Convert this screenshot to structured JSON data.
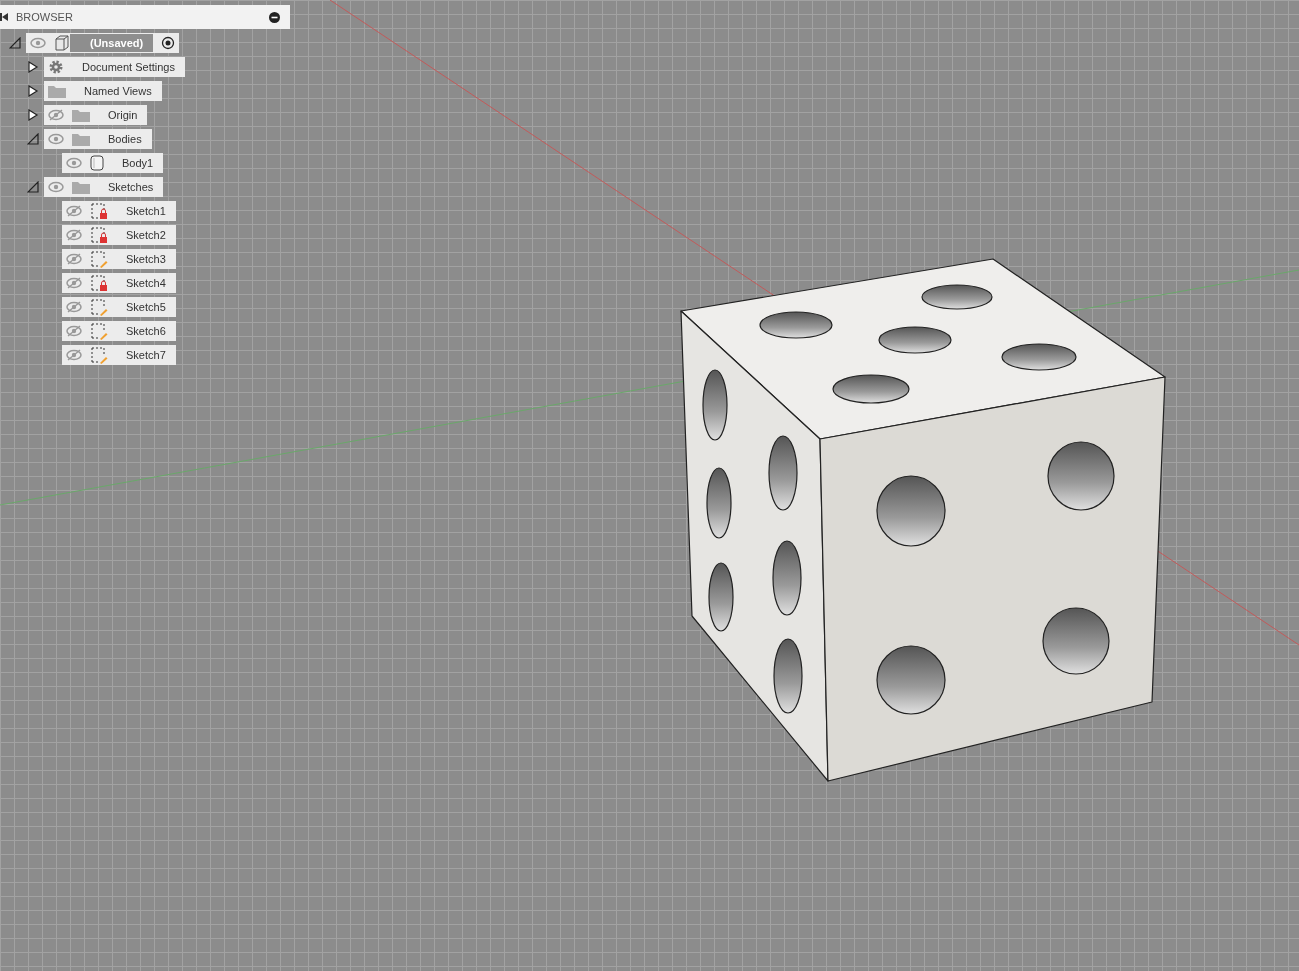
{
  "browser": {
    "title": "BROWSER",
    "tree": [
      {
        "kind": "component",
        "label": "(Unsaved)",
        "expanded": true,
        "visible": true,
        "active": true,
        "children": [
          {
            "kind": "settings",
            "label": "Document Settings",
            "expanded": false
          },
          {
            "kind": "folder",
            "label": "Named Views",
            "expanded": false
          },
          {
            "kind": "folder",
            "label": "Origin",
            "expanded": false,
            "visible": false
          },
          {
            "kind": "folder",
            "label": "Bodies",
            "expanded": true,
            "visible": true,
            "children": [
              {
                "kind": "body",
                "label": "Body1",
                "visible": true
              }
            ]
          },
          {
            "kind": "folder",
            "label": "Sketches",
            "expanded": true,
            "visible": true,
            "children": [
              {
                "kind": "sketch",
                "label": "Sketch1",
                "visible": false,
                "locked": true
              },
              {
                "kind": "sketch",
                "label": "Sketch2",
                "visible": false,
                "locked": true
              },
              {
                "kind": "sketch",
                "label": "Sketch3",
                "visible": false,
                "locked": false
              },
              {
                "kind": "sketch",
                "label": "Sketch4",
                "visible": false,
                "locked": true
              },
              {
                "kind": "sketch",
                "label": "Sketch5",
                "visible": false,
                "locked": false
              },
              {
                "kind": "sketch",
                "label": "Sketch6",
                "visible": false,
                "locked": false
              },
              {
                "kind": "sketch",
                "label": "Sketch7",
                "visible": false,
                "locked": false
              }
            ]
          }
        ]
      }
    ]
  }
}
